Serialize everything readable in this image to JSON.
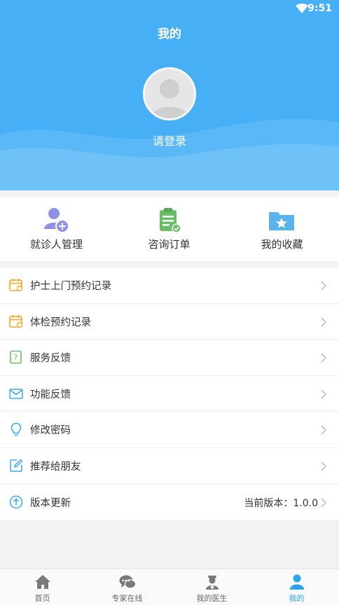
{
  "status_bar": {
    "time": "9:51"
  },
  "header": {
    "title": "我的",
    "login_label": "请登录"
  },
  "quick_actions": [
    {
      "label": "就诊人管理",
      "icon": "add-user-icon"
    },
    {
      "label": "咨询订单",
      "icon": "clipboard-check-icon"
    },
    {
      "label": "我的收藏",
      "icon": "folder-star-icon"
    }
  ],
  "menu": [
    {
      "label": "护士上门预约记录",
      "icon": "calendar-icon"
    },
    {
      "label": "体检预约记录",
      "icon": "calendar-icon"
    },
    {
      "label": "服务反馈",
      "icon": "feedback-question-icon"
    },
    {
      "label": "功能反馈",
      "icon": "mail-icon"
    },
    {
      "label": "修改密码",
      "icon": "lightbulb-icon"
    },
    {
      "label": "推荐给朋友",
      "icon": "share-edit-icon"
    },
    {
      "label": "版本更新",
      "icon": "upload-circle-icon",
      "value": "当前版本：1.0.0"
    }
  ],
  "tabs": [
    {
      "label": "首页",
      "icon": "home-icon"
    },
    {
      "label": "专家在线",
      "icon": "chat-bubbles-icon"
    },
    {
      "label": "我的医生",
      "icon": "doctor-icon"
    },
    {
      "label": "我的",
      "icon": "person-icon",
      "active": true
    }
  ],
  "colors": {
    "header_blue": "#46aff5",
    "accent_blue": "#2aa4f0",
    "icon_orange": "#f5a623",
    "icon_green": "#6cbd6a",
    "icon_purple": "#8e8fe6"
  }
}
